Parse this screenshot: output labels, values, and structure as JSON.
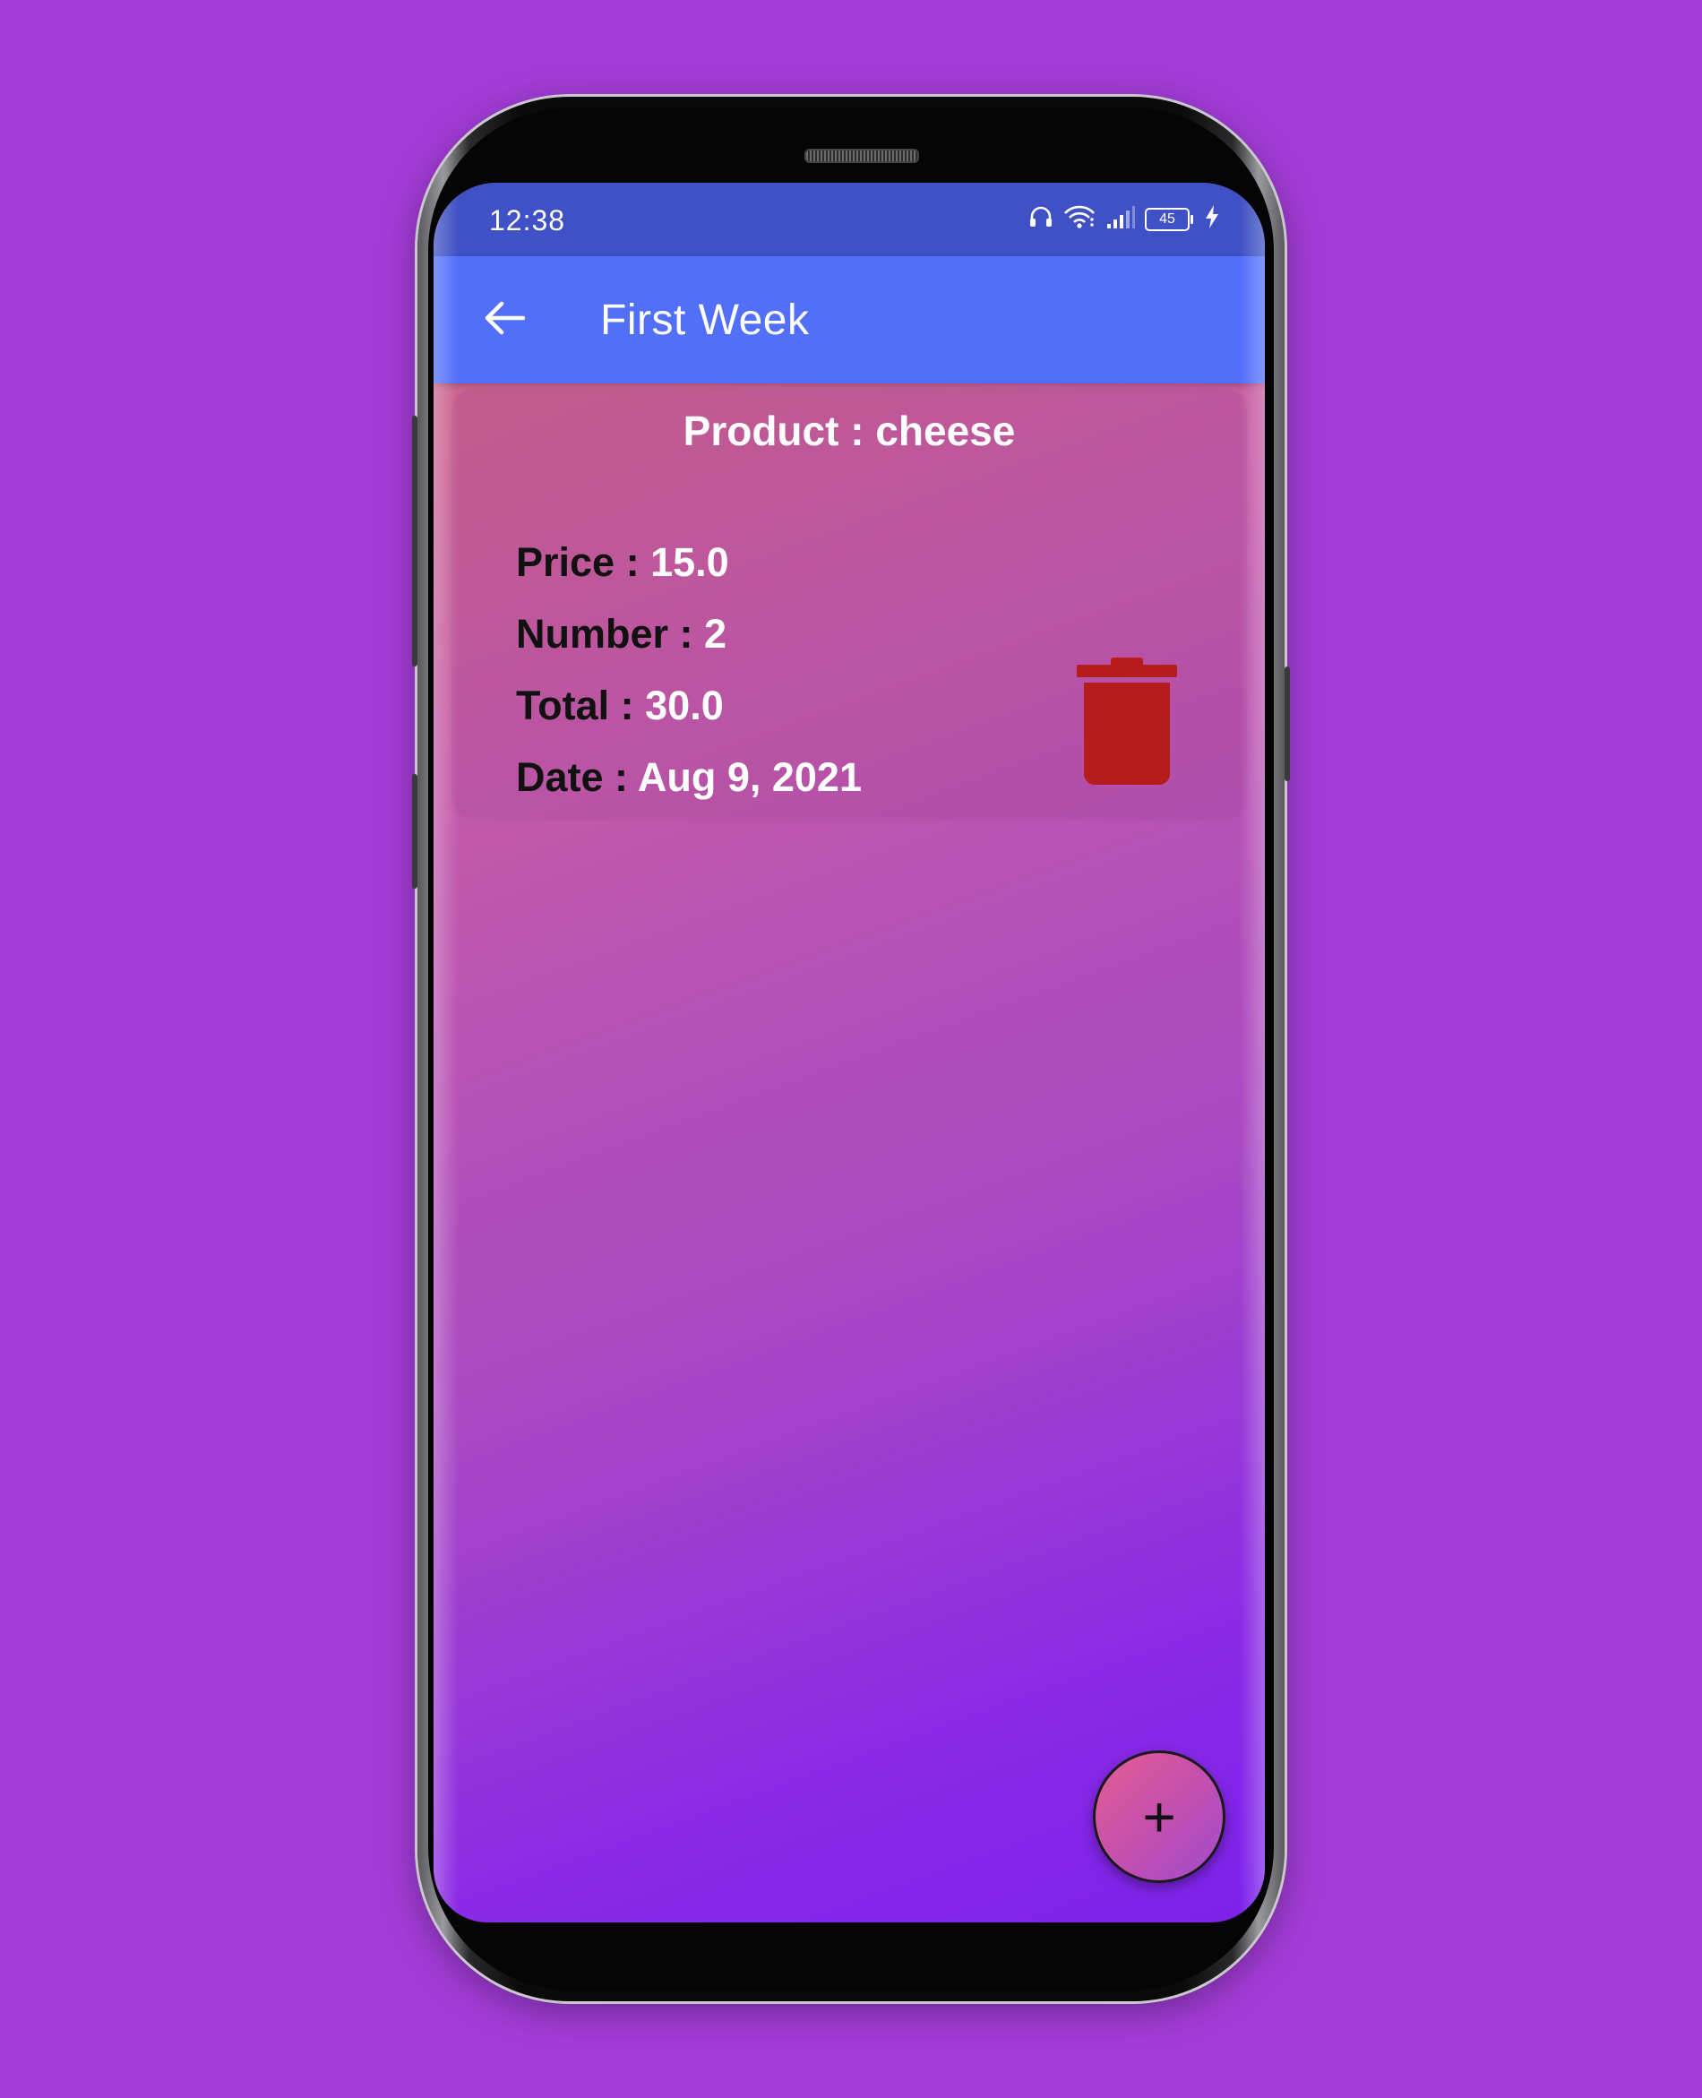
{
  "status_bar": {
    "time": "12:38",
    "battery_level": "45",
    "icons": [
      "headphones-icon",
      "wifi-icon",
      "signal-icon",
      "battery-icon",
      "charging-icon"
    ]
  },
  "app_bar": {
    "title": "First Week",
    "back_icon": "arrow-left-icon"
  },
  "product_card": {
    "title": "Product : cheese",
    "price_label": "Price : ",
    "price_value": "15.0",
    "number_label": "Number : ",
    "number_value": "2",
    "total_label": "Total : ",
    "total_value": "30.0",
    "date_label": "Date : ",
    "date_value": "Aug 9, 2021",
    "delete_icon": "trash-icon",
    "delete_color": "#b71c1c"
  },
  "fab": {
    "label": "+",
    "icon": "plus-icon"
  },
  "colors": {
    "background": "#a23cd7",
    "status_bar": "#3f51c4",
    "app_bar": "#516ff9",
    "gradient_top": "#d0697f",
    "gradient_bottom": "#7e22ec"
  }
}
